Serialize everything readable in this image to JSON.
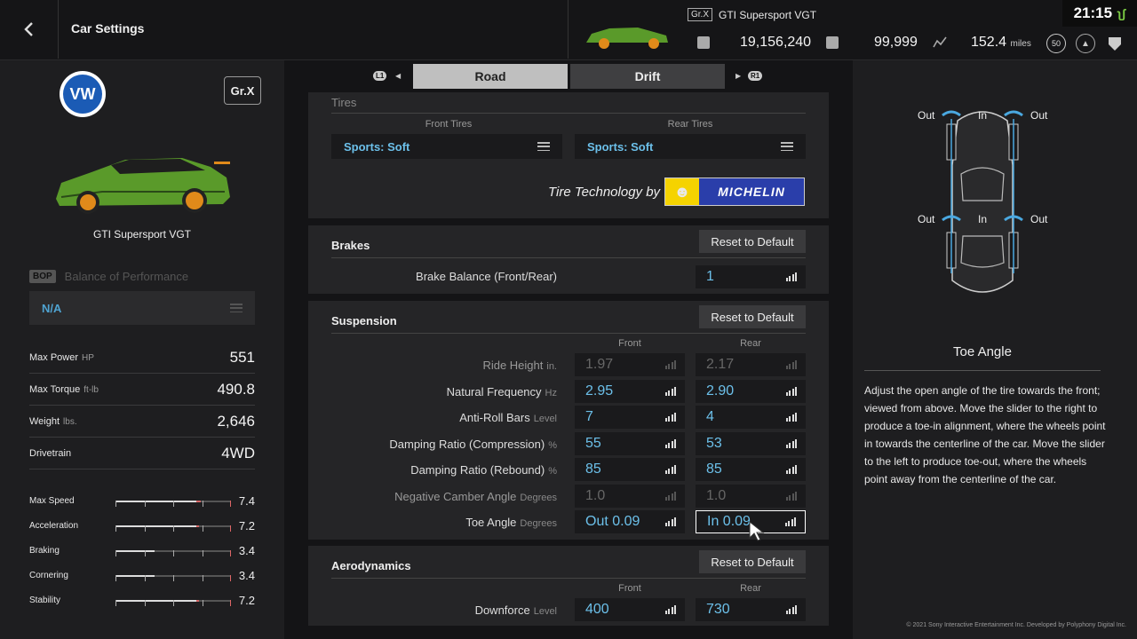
{
  "header": {
    "title": "Car Settings",
    "car_class": "Gr.X",
    "car_name": "GTI Supersport VGT",
    "credits": "19,156,240",
    "mileage_points": "99,999",
    "distance": "152.4",
    "distance_unit": "miles",
    "level": "50",
    "clock": "21:15",
    "signal": "ʅʃ"
  },
  "left": {
    "brand_logo": "VW",
    "car_class": "Gr.X",
    "car_name": "GTI Supersport VGT",
    "bop_tag": "BOP",
    "bop_label": "Balance of Performance",
    "bop_value": "N/A",
    "specs": [
      {
        "label": "Max Power",
        "unit": "HP",
        "value": "551"
      },
      {
        "label": "Max Torque",
        "unit": "ft-lb",
        "value": "490.8"
      },
      {
        "label": "Weight",
        "unit": "lbs.",
        "value": "2,646"
      },
      {
        "label": "Drivetrain",
        "unit": "",
        "value": "4WD"
      }
    ],
    "performance": [
      {
        "label": "Max Speed",
        "value": "7.4",
        "level": 0.74
      },
      {
        "label": "Acceleration",
        "value": "7.2",
        "level": 0.72
      },
      {
        "label": "Braking",
        "value": "3.4",
        "level": 0.34
      },
      {
        "label": "Cornering",
        "value": "3.4",
        "level": 0.34
      },
      {
        "label": "Stability",
        "value": "7.2",
        "level": 0.72
      }
    ]
  },
  "tabs": {
    "left_hint": "L1",
    "right_hint": "R1",
    "road": "Road",
    "drift": "Drift"
  },
  "tires": {
    "title": "Tires",
    "front_head": "Front Tires",
    "rear_head": "Rear Tires",
    "front_value": "Sports: Soft",
    "rear_value": "Sports: Soft",
    "tech_text": "Tire Technology by",
    "brand": "MICHELIN"
  },
  "brakes": {
    "title": "Brakes",
    "reset": "Reset to Default",
    "label": "Brake Balance (Front/Rear)",
    "value": "1"
  },
  "suspension": {
    "title": "Suspension",
    "reset": "Reset to Default",
    "front_head": "Front",
    "rear_head": "Rear",
    "rows": [
      {
        "label": "Ride Height",
        "unit": "in.",
        "front": "1.97",
        "rear": "2.17",
        "dim": true
      },
      {
        "label": "Natural Frequency",
        "unit": "Hz",
        "front": "2.95",
        "rear": "2.90",
        "dim": false
      },
      {
        "label": "Anti-Roll Bars",
        "unit": "Level",
        "front": "7",
        "rear": "4",
        "dim": false
      },
      {
        "label": "Damping Ratio (Compression)",
        "unit": "%",
        "front": "55",
        "rear": "53",
        "dim": false
      },
      {
        "label": "Damping Ratio (Rebound)",
        "unit": "%",
        "front": "85",
        "rear": "85",
        "dim": false
      },
      {
        "label": "Negative Camber Angle",
        "unit": "Degrees",
        "front": "1.0",
        "rear": "1.0",
        "dim": true
      },
      {
        "label": "Toe Angle",
        "unit": "Degrees",
        "front": "Out 0.09",
        "rear": "In 0.09",
        "dim": false
      }
    ]
  },
  "aero": {
    "title": "Aerodynamics",
    "reset": "Reset to Default",
    "front_head": "Front",
    "rear_head": "Rear",
    "label": "Downforce",
    "unit": "Level",
    "front": "400",
    "rear": "730"
  },
  "help": {
    "diagram_out": "Out",
    "diagram_in": "In",
    "title": "Toe Angle",
    "text": "Adjust the open angle of the tire towards the front; viewed from above. Move the slider to the right to produce a toe-in alignment, where the wheels point in towards the centerline of the car. Move the slider to the left to produce toe-out, where the wheels point away from the centerline of the car.",
    "copyright": "© 2021 Sony Interactive Entertainment Inc. Developed by Polyphony Digital Inc."
  },
  "colors": {
    "accent_value": "#6cc0ea",
    "car_green": "#5a9a2a",
    "car_orange": "#e08a1a",
    "slider_red": "#d66666"
  }
}
